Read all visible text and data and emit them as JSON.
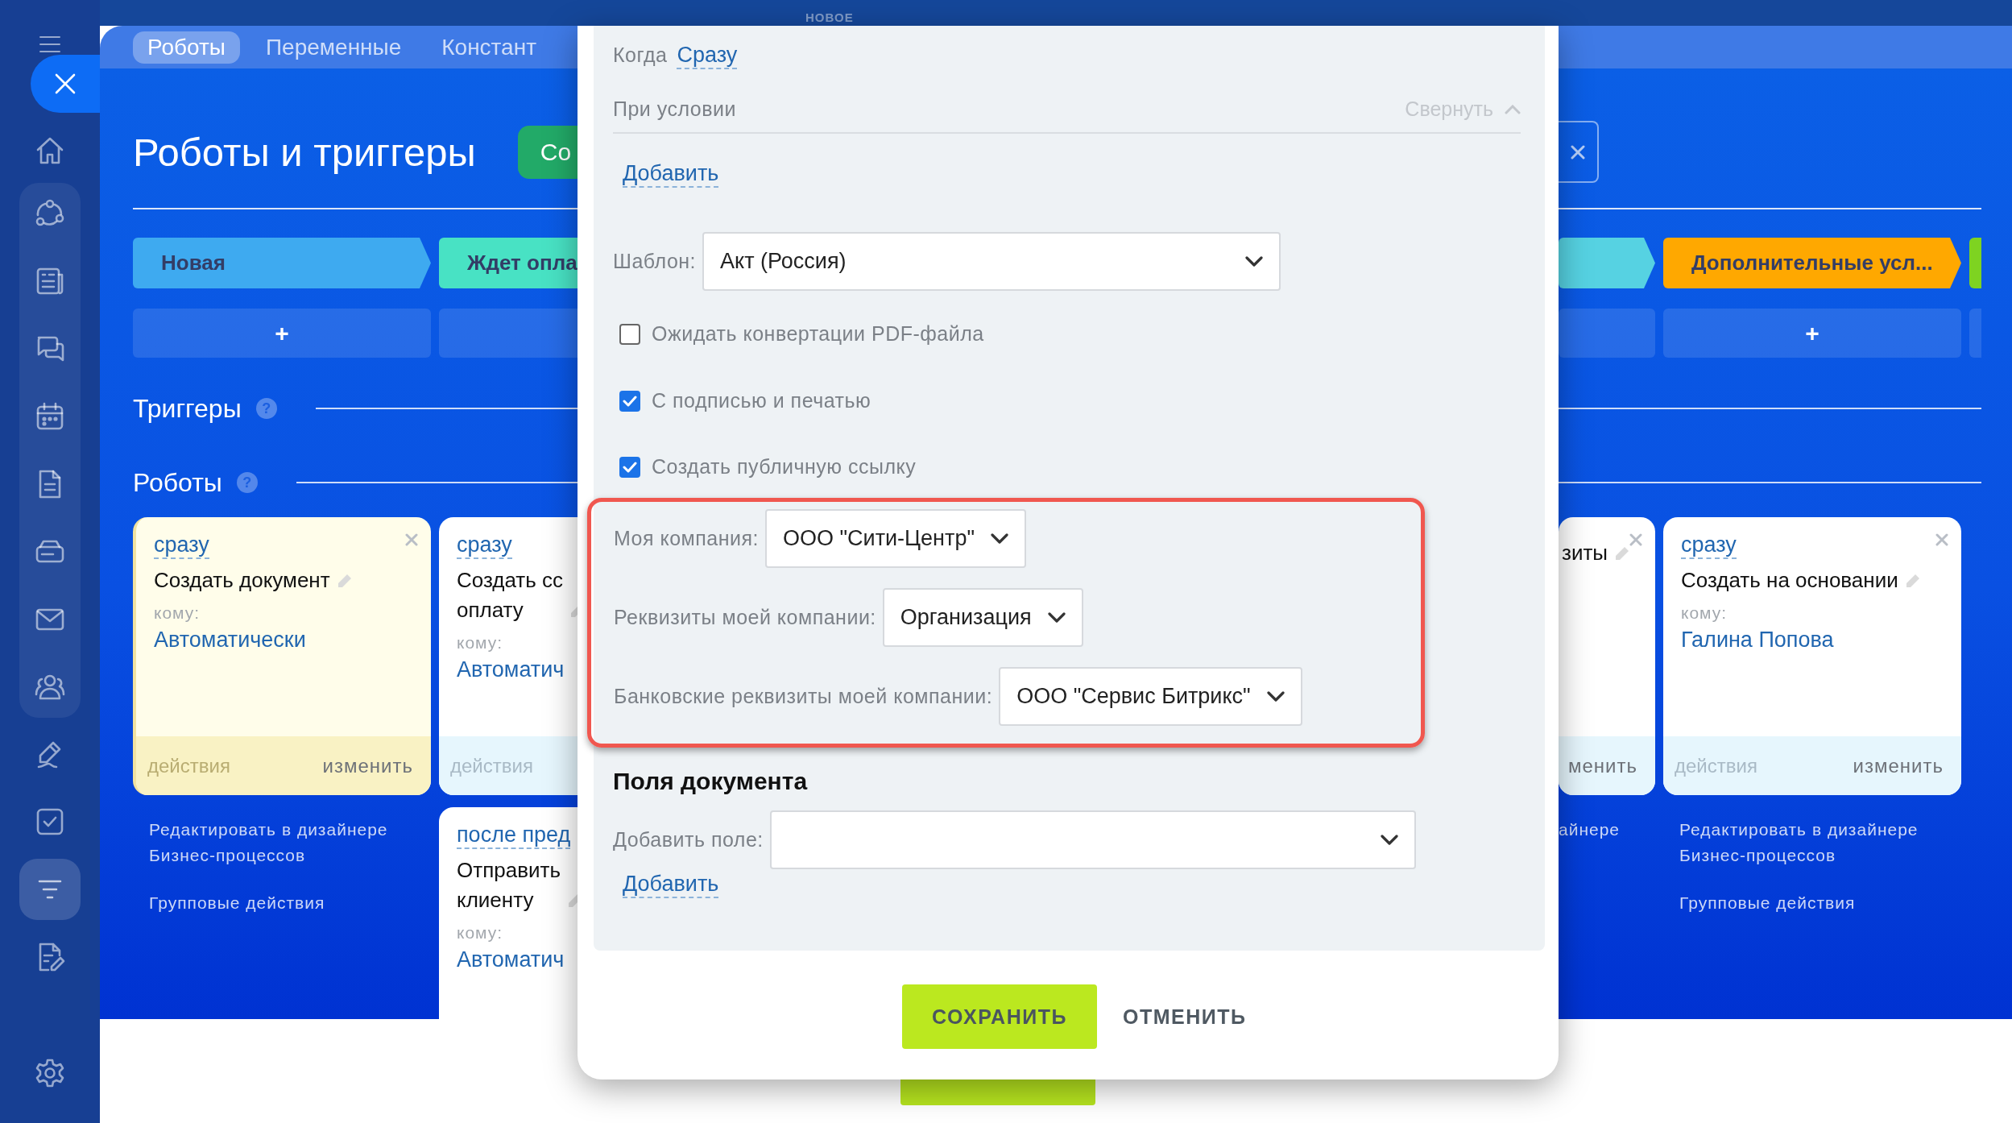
{
  "page": {
    "badge": "НОВОЕ"
  },
  "sidebar": {
    "items": [
      {
        "kind": "menu",
        "selected": false,
        "grouped": false
      },
      {
        "kind": "close",
        "selected": false,
        "grouped": false
      },
      {
        "kind": "home",
        "selected": false,
        "grouped": false
      },
      {
        "kind": "flow",
        "selected": false,
        "grouped": true
      },
      {
        "kind": "news",
        "selected": false,
        "grouped": true
      },
      {
        "kind": "chat",
        "selected": false,
        "grouped": true
      },
      {
        "kind": "calendar",
        "selected": false,
        "grouped": true
      },
      {
        "kind": "document",
        "selected": false,
        "grouped": true
      },
      {
        "kind": "drive",
        "selected": false,
        "grouped": true
      },
      {
        "kind": "mail",
        "selected": false,
        "grouped": true
      },
      {
        "kind": "people",
        "selected": false,
        "grouped": true
      },
      {
        "kind": "sign",
        "selected": false,
        "grouped": false
      },
      {
        "kind": "task",
        "selected": false,
        "grouped": false
      },
      {
        "kind": "filter",
        "selected": true,
        "grouped": false
      },
      {
        "kind": "edit",
        "selected": false,
        "grouped": false
      },
      {
        "kind": "settings",
        "selected": false,
        "grouped": false
      }
    ]
  },
  "board": {
    "tabs": [
      {
        "label": "Роботы",
        "selected": true
      },
      {
        "label": "Переменные",
        "selected": false
      },
      {
        "label": "Констант",
        "selected": false
      }
    ],
    "title": "Роботы и триггеры",
    "create_button": "Со",
    "triggers_heading": {
      "text": "Триггеры",
      "help": "?"
    },
    "robots_heading": {
      "text": "Роботы",
      "help": "?"
    },
    "left_columns": [
      {
        "stage": {
          "name": "Новая",
          "color": "#3eaaf0"
        },
        "add": "+",
        "items": [
          {
            "kind": "card",
            "highlighted": true,
            "closable": true,
            "delay": "сразу",
            "title": "Создать документ",
            "recipient_label": "кому:",
            "recipient": "Автоматически",
            "actions": "действия",
            "edit": "изменить"
          },
          {
            "kind": "link",
            "text": "Редактировать в дизайнере\nБизнес-процессов"
          },
          {
            "kind": "link",
            "text": "Групповые действия"
          }
        ]
      },
      {
        "stage": {
          "name": "Ждет опла",
          "color": "#48e2c4"
        },
        "items": [
          {
            "kind": "card",
            "highlighted": false,
            "delay": "сразу",
            "title": "Создать сс\nоплату",
            "recipient_label": "кому:",
            "recipient": "Автоматич",
            "actions": "действия"
          },
          {
            "kind": "card",
            "highlighted": false,
            "delay": "после пред",
            "title": "Отправить\nклиенту",
            "recipient_label": "кому:",
            "recipient": "Автоматич"
          }
        ]
      }
    ],
    "right_columns": [
      {
        "stage": {
          "color": "#56d2e2"
        },
        "items": [
          {
            "kind": "card",
            "highlighted": false,
            "closable": true,
            "title": "зиты",
            "edit": "менить"
          },
          {
            "kind": "link",
            "text": "айнере"
          }
        ]
      },
      {
        "stage": {
          "name": "Дополнительные усл...",
          "color": "#ffa800"
        },
        "add": "+",
        "items": [
          {
            "kind": "card",
            "highlighted": false,
            "closable": true,
            "delay": "сразу",
            "title": "Создать на основании",
            "recipient_label": "кому:",
            "recipient": "Галина Попова",
            "actions": "действия",
            "edit": "изменить"
          },
          {
            "kind": "link",
            "text": "Редактировать в дизайнере\nБизнес-процессов"
          },
          {
            "kind": "link",
            "text": "Групповые действия"
          }
        ]
      },
      {
        "stage": {
          "color": "#7ed321"
        }
      }
    ]
  },
  "dialog": {
    "when_label": "Когда",
    "when_value": "Сразу",
    "condition_label": "При условии",
    "collapse": "Свернуть",
    "add_condition": "Добавить",
    "template": {
      "label": "Шаблон:",
      "value": "Акт (Россия)"
    },
    "options": [
      {
        "label": "Ожидать конвертации PDF-файла",
        "checked": false
      },
      {
        "label": "С подписью и печатью",
        "checked": true
      },
      {
        "label": "Создать публичную ссылку",
        "checked": true
      }
    ],
    "company_fields": [
      {
        "label": "Моя компания:",
        "value": "ООО \"Сити-Центр\""
      },
      {
        "label": "Реквизиты моей компании:",
        "value": "Организация"
      },
      {
        "label": "Банковские реквизиты моей компании:",
        "value": "ООО \"Сервис Битрикс\""
      }
    ],
    "section_title": "Поля документа",
    "add_field": {
      "label": "Добавить поле:"
    },
    "add_link": "Добавить",
    "buttons": [
      {
        "label": "СОХРАНИТЬ",
        "kind": "primary"
      },
      {
        "label": "ОТМЕНИТЬ",
        "kind": "link"
      }
    ]
  }
}
